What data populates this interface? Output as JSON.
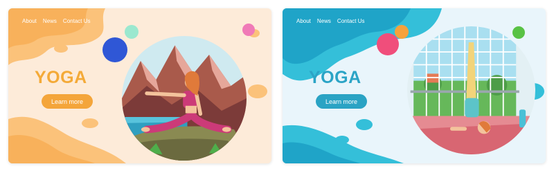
{
  "panels": [
    {
      "nav": [
        "About",
        "News",
        "Contact Us"
      ],
      "title": "YOGA",
      "button_label": "Learn more",
      "colors": {
        "background": "#fdebd9",
        "accent": "#f4a53a",
        "title": "#f4aa38",
        "blob": "#fbc27a"
      },
      "illustration": "woman-side-lunge-stretch-mountain-lake"
    },
    {
      "nav": [
        "About",
        "News",
        "Contact Us"
      ],
      "title": "YOGA",
      "button_label": "Learn more",
      "colors": {
        "background": "#e9f5fb",
        "accent": "#2aa3c4",
        "title": "#2ba4c6",
        "blob": "#34bfd9"
      },
      "illustration": "woman-shoulder-stand-by-window"
    }
  ]
}
